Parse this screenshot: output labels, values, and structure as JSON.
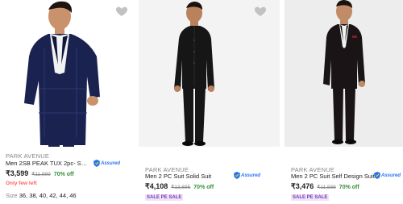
{
  "products": [
    {
      "brand": "PARK AVENUE",
      "title": "Men 2SB PEAK TUX 2pc- SUPE...",
      "assured": "Assured",
      "price": "₹3,599",
      "mrp": "₹11,999",
      "off": "70% off",
      "stock": "Only few left",
      "size_label": "Size",
      "sizes": "36, 38, 40, 42, 44, 46",
      "suit_color": "#1a2350",
      "bg_color": "#ffffff"
    },
    {
      "brand": "PARK AVENUE",
      "title": "Men 2 PC Suit Solid Suit",
      "assured": "Assured",
      "price": "₹4,108",
      "mrp": "₹13,695",
      "off": "70% off",
      "sale_tag": "SALE PE SALE",
      "suit_color": "#161616",
      "bg_color": "#f3f3f3"
    },
    {
      "brand": "PARK AVENUE",
      "title": "Men 2 PC Suit Self Design Suit",
      "assured": "Assured",
      "price": "₹3,476",
      "mrp": "₹11,588",
      "off": "70% off",
      "sale_tag": "SALE PE SALE",
      "suit_color": "#1b1416",
      "bg_color": "#ededed"
    }
  ]
}
